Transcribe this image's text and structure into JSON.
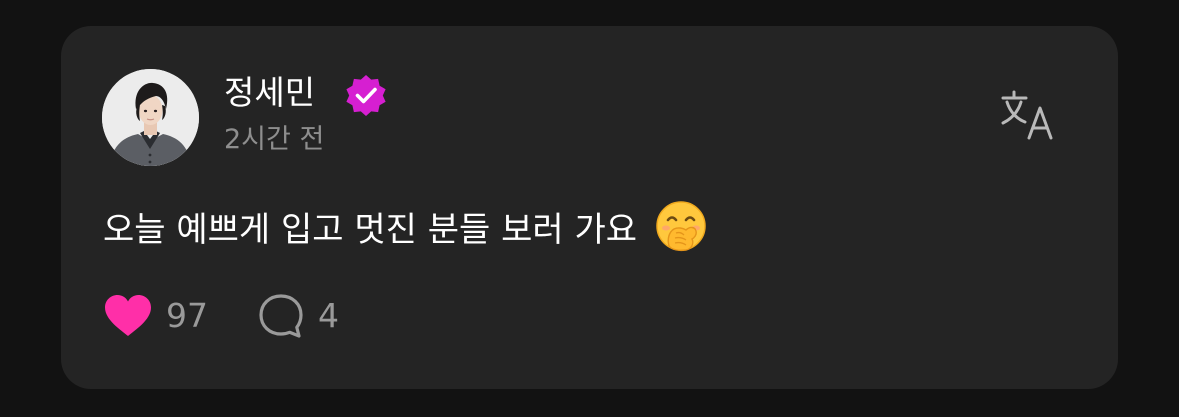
{
  "post": {
    "author": {
      "name": "정세민",
      "verified": true,
      "avatar": "avatar-photo"
    },
    "timestamp": "2시간 전",
    "text": "오늘 예쁘게 입고 멋진 분들 보러 가요",
    "emoji": "hand-over-mouth-emoji",
    "actions": {
      "like_count": "97",
      "comment_count": "4"
    },
    "icons": {
      "verified": "verified-badge-icon",
      "translate": "translate-icon",
      "like": "heart-icon",
      "comment": "comment-bubble-icon"
    }
  },
  "colors": {
    "background": "#121212",
    "card": "#242424",
    "accent_heart": "#ff2fa8",
    "verified_badge": "#d61fd1",
    "muted_text": "#8e8e8e"
  }
}
